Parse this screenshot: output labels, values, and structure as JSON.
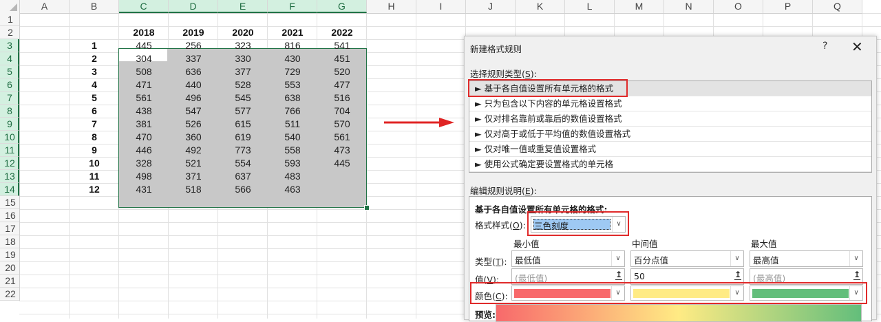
{
  "sheet": {
    "column_headers": [
      "A",
      "B",
      "C",
      "D",
      "E",
      "F",
      "G",
      "H",
      "I",
      "J",
      "K",
      "L",
      "M",
      "N",
      "O",
      "P",
      "Q"
    ],
    "row_numbers": [
      "1",
      "2",
      "3",
      "4",
      "5",
      "6",
      "7",
      "8",
      "9",
      "10",
      "11",
      "12",
      "13",
      "14",
      "15",
      "16",
      "17",
      "18",
      "19",
      "20",
      "21",
      "22"
    ],
    "years": [
      "2018",
      "2019",
      "2020",
      "2021",
      "2022"
    ],
    "index": [
      "1",
      "2",
      "3",
      "4",
      "5",
      "6",
      "7",
      "8",
      "9",
      "10",
      "11",
      "12"
    ],
    "rows": [
      [
        "445",
        "256",
        "323",
        "816",
        "541"
      ],
      [
        "304",
        "337",
        "330",
        "430",
        "451"
      ],
      [
        "508",
        "636",
        "377",
        "729",
        "520"
      ],
      [
        "471",
        "440",
        "528",
        "553",
        "477"
      ],
      [
        "561",
        "496",
        "545",
        "638",
        "516"
      ],
      [
        "438",
        "547",
        "577",
        "766",
        "704"
      ],
      [
        "381",
        "526",
        "615",
        "511",
        "570"
      ],
      [
        "470",
        "360",
        "619",
        "540",
        "561"
      ],
      [
        "446",
        "492",
        "773",
        "558",
        "473"
      ],
      [
        "328",
        "521",
        "554",
        "593",
        "445"
      ],
      [
        "498",
        "371",
        "637",
        "483",
        ""
      ],
      [
        "431",
        "518",
        "566",
        "463",
        ""
      ]
    ]
  },
  "dialog": {
    "title": "新建格式规则",
    "help": "?",
    "close": "✕",
    "select_type_label": "选择规则类型(",
    "select_type_key": "S",
    "select_type_suffix": "):",
    "rule_types": [
      "► 基于各自值设置所有单元格的格式",
      "► 只为包含以下内容的单元格设置格式",
      "► 仅对排名靠前或靠后的数值设置格式",
      "► 仅对高于或低于平均值的数值设置格式",
      "► 仅对唯一值或重复值设置格式",
      "► 使用公式确定要设置格式的单元格"
    ],
    "edit_label": "编辑规则说明(",
    "edit_key": "E",
    "edit_suffix": "):",
    "desc_heading": "基于各自值设置所有单元格的格式:",
    "format_style_label": "格式样式(",
    "format_style_key": "O",
    "format_style_suffix": "):",
    "format_style_value": "三色刻度",
    "min_header": "最小值",
    "mid_header": "中间值",
    "max_header": "最大值",
    "type_label": "类型(",
    "type_key": "T",
    "type_suffix": "):",
    "min_type": "最低值",
    "mid_type": "百分点值",
    "max_type": "最高值",
    "value_label": "值(",
    "value_key": "V",
    "value_suffix": "):",
    "min_value_placeholder": "(最低值)",
    "mid_value": "50",
    "max_value_placeholder": "(最高值)",
    "color_label": "颜色(",
    "color_key": "C",
    "color_suffix": "):",
    "preview_label": "预览:",
    "colors": {
      "min": "#f8696b",
      "mid": "#ffeb84",
      "max": "#63be7b"
    }
  },
  "icons": {
    "dropdown": "chevron-down-icon",
    "ref": "collapse-ref-icon",
    "arrow": "red-arrow"
  }
}
